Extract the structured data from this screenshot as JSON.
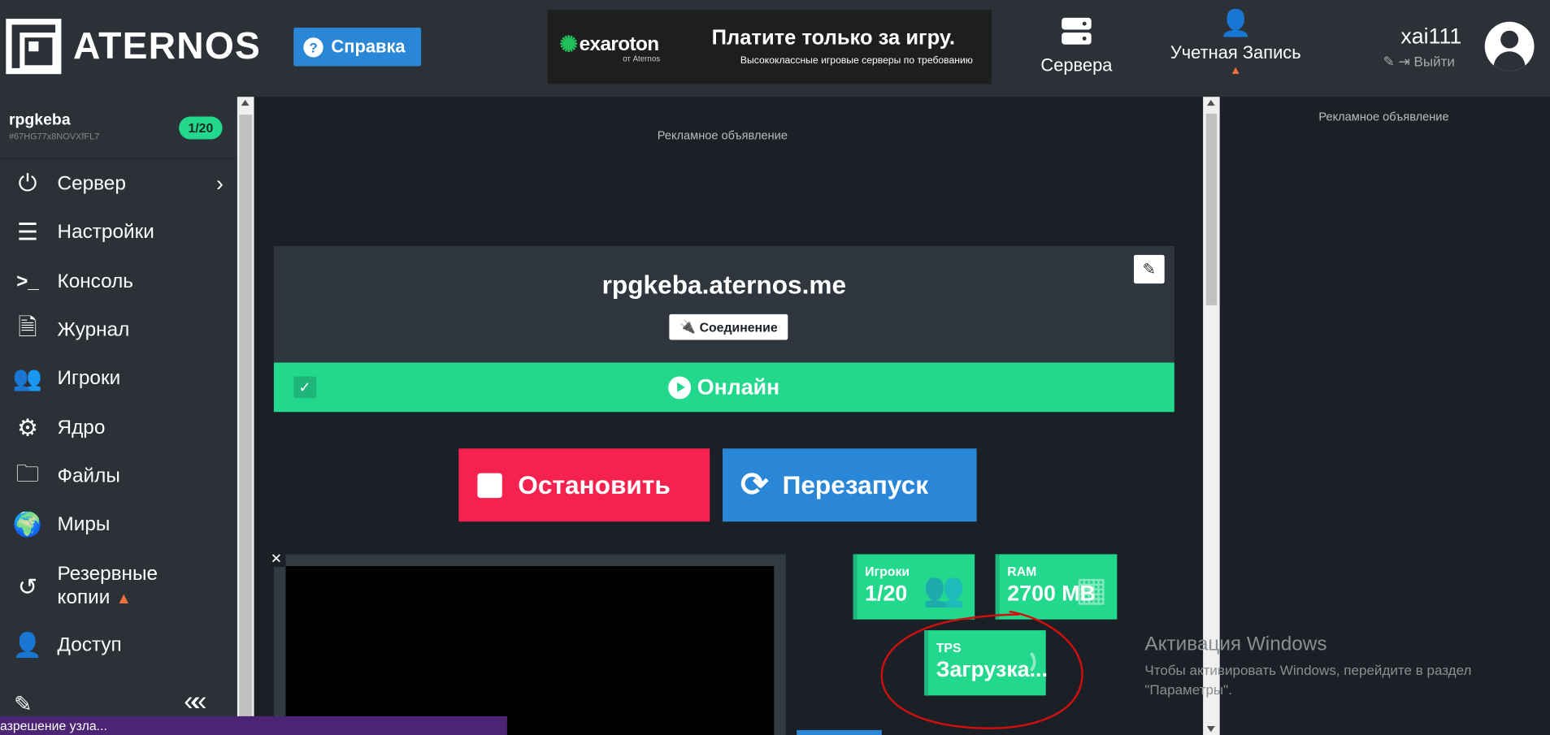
{
  "header": {
    "logo_text": "ATERNOS",
    "help_label": "Справка",
    "banner": {
      "brand": "exaroton",
      "brand_sub": "от Aternos",
      "title": "Платите только за игру.",
      "desc": "Высококлассные игровые серверы по требованию"
    },
    "servers_label": "Сервера",
    "account_label": "Учетная Запись",
    "username": "xai111",
    "logout_label": "Выйти"
  },
  "sidebar": {
    "server_name": "rpgkeba",
    "server_id": "#67HG77x8NOVXfFL7",
    "player_count": "1/20",
    "items": [
      {
        "label": "Сервер",
        "icon": "power-icon"
      },
      {
        "label": "Настройки",
        "icon": "sliders-icon"
      },
      {
        "label": "Консоль",
        "icon": "terminal-icon"
      },
      {
        "label": "Журнал",
        "icon": "file-icon"
      },
      {
        "label": "Игроки",
        "icon": "users-icon"
      },
      {
        "label": "Ядро",
        "icon": "gears-icon"
      },
      {
        "label": "Файлы",
        "icon": "folder-icon"
      },
      {
        "label": "Миры",
        "icon": "globe-icon"
      },
      {
        "label": "Резервные копии",
        "label1": "Резервные",
        "label2": "копии",
        "icon": "history-icon"
      },
      {
        "label": "Доступ",
        "icon": "user-lock-icon"
      }
    ]
  },
  "main": {
    "ad_label": "Рекламное объявление",
    "address": "rpgkeba.aternos.me",
    "connect_label": "Соединение",
    "status": "Онлайн",
    "stop_label": "Остановить",
    "restart_label": "Перезапуск",
    "stats": {
      "players_label": "Игроки",
      "players_value": "1/20",
      "ram_label": "RAM",
      "ram_value": "2700 MB",
      "tps_label": "TPS",
      "tps_value": "Загрузка..."
    }
  },
  "right": {
    "ad_label": "Рекламное объявление"
  },
  "windows": {
    "title": "Активация Windows",
    "text": "Чтобы активировать Windows, перейдите в раздел \"Параметры\"."
  },
  "statusbar": {
    "text": "азрешение узла..."
  },
  "colors": {
    "accent_green": "#22d88c",
    "accent_blue": "#2a86d6",
    "stop_red": "#f5214e",
    "panel_dark": "#2b3137",
    "warning": "#f0703c"
  }
}
